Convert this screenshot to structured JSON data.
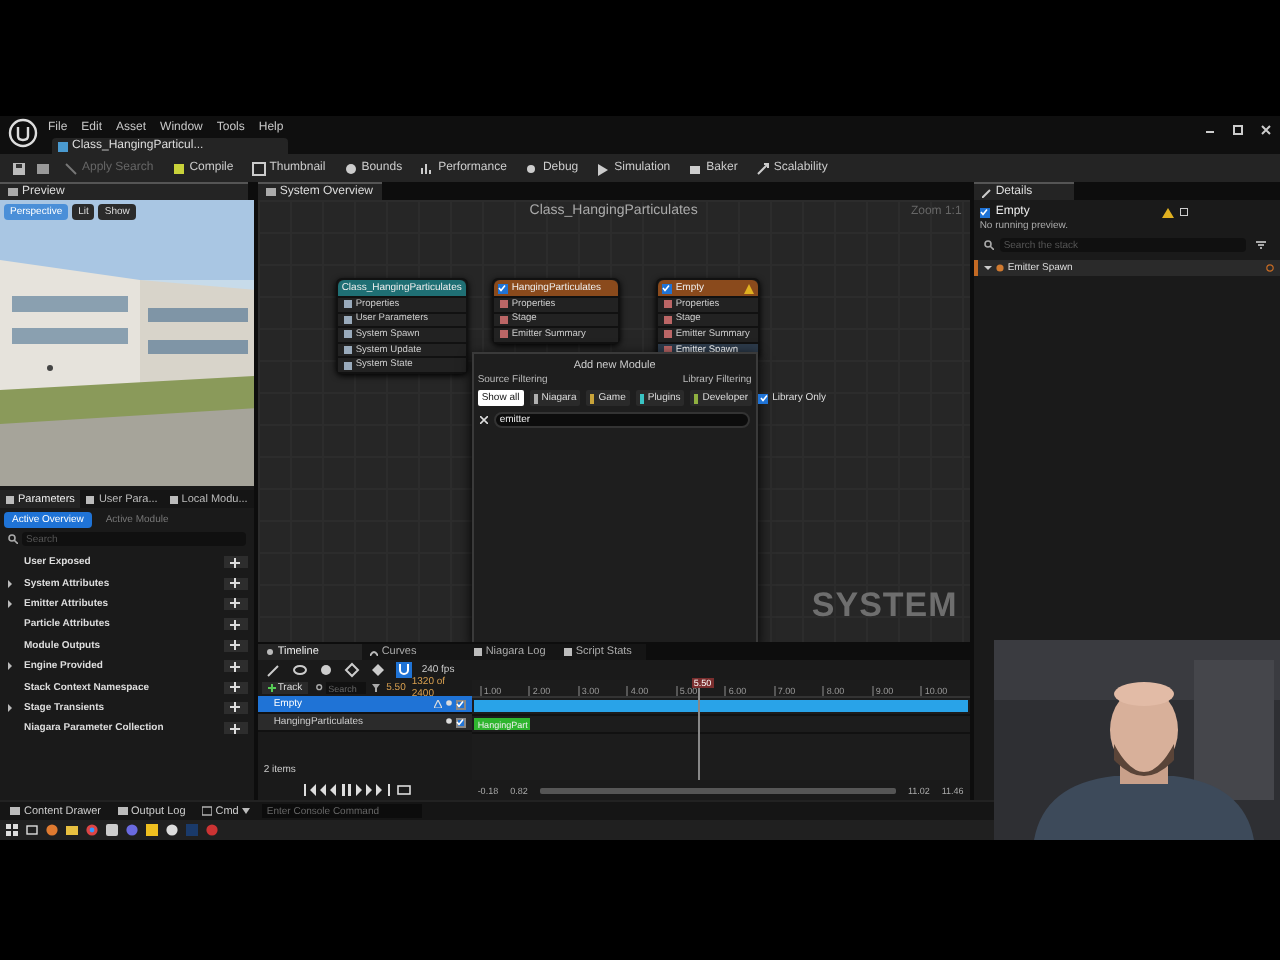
{
  "menu": [
    "File",
    "Edit",
    "Asset",
    "Window",
    "Tools",
    "Help"
  ],
  "document_tab": "Class_HangingParticul...",
  "toolbar": [
    {
      "label": "Apply Search",
      "disabled": true
    },
    {
      "label": "Compile",
      "disabled": false
    },
    {
      "label": "Thumbnail",
      "disabled": false
    },
    {
      "label": "Bounds",
      "disabled": false
    },
    {
      "label": "Performance",
      "disabled": false
    },
    {
      "label": "Debug",
      "disabled": false
    },
    {
      "label": "Simulation",
      "disabled": false
    },
    {
      "label": "Baker",
      "disabled": false
    },
    {
      "label": "Scalability",
      "disabled": false
    }
  ],
  "preview": {
    "tab": "Preview",
    "buttons": [
      "Perspective",
      "Lit",
      "Show"
    ]
  },
  "parameters": {
    "tabs": [
      {
        "label": "Parameters",
        "selected": true
      },
      {
        "label": "User Para...",
        "selected": false
      },
      {
        "label": "Local Modu...",
        "selected": false
      }
    ],
    "modes": [
      {
        "label": "Active Overview",
        "selected": true
      },
      {
        "label": "Active Module",
        "selected": false
      }
    ],
    "search_placeholder": "Search",
    "groups": [
      {
        "label": "User Exposed",
        "expandable": false
      },
      {
        "label": "System Attributes",
        "expandable": true
      },
      {
        "label": "Emitter Attributes",
        "expandable": true
      },
      {
        "label": "Particle Attributes",
        "expandable": false
      },
      {
        "label": "Module Outputs",
        "expandable": false
      },
      {
        "label": "Engine Provided",
        "expandable": true
      },
      {
        "label": "Stack Context Namespace",
        "expandable": false
      },
      {
        "label": "Stage Transients",
        "expandable": true
      },
      {
        "label": "Niagara Parameter Collection",
        "expandable": false
      }
    ]
  },
  "graph": {
    "tab": "System Overview",
    "title": "Class_HangingParticulates",
    "zoom": "Zoom 1:1",
    "watermark": "SYSTEM",
    "system_node": {
      "title": "Class_HangingParticulates",
      "rows": [
        {
          "label": "Properties",
          "selected": false
        },
        {
          "label": "User Parameters",
          "selected": false
        },
        {
          "label": "System Spawn",
          "selected": false
        },
        {
          "label": "System Update",
          "selected": false
        },
        {
          "label": "System State",
          "selected": false
        }
      ]
    },
    "emitter_nodes": [
      {
        "title": "HangingParticulates",
        "enabled": true,
        "warning": false,
        "rows": [
          {
            "label": "Properties",
            "selected": false
          },
          {
            "label": "Stage",
            "selected": false
          },
          {
            "label": "Emitter Summary",
            "selected": false
          }
        ]
      },
      {
        "title": "Empty",
        "enabled": true,
        "warning": true,
        "rows": [
          {
            "label": "Properties",
            "selected": false
          },
          {
            "label": "Stage",
            "selected": false
          },
          {
            "label": "Emitter Summary",
            "selected": false
          },
          {
            "label": "Emitter Spawn",
            "selected": true
          }
        ]
      }
    ],
    "add_module": {
      "title": "Add new Module",
      "source_filtering": "Source Filtering",
      "library_filtering": "Library Filtering",
      "filters": [
        {
          "label": "Show all",
          "color": "#ffffff"
        },
        {
          "label": "Niagara",
          "color": "#b0b0b0"
        },
        {
          "label": "Game",
          "color": "#c9a43a"
        },
        {
          "label": "Plugins",
          "color": "#3ac4c4"
        },
        {
          "label": "Developer",
          "color": "#8fb040"
        }
      ],
      "library_only": {
        "label": "Library Only",
        "checked": true
      },
      "search": "emitter"
    }
  },
  "timeline": {
    "tabs": [
      {
        "label": "Timeline",
        "selected": true
      },
      {
        "label": "Curves",
        "selected": false
      },
      {
        "label": "Niagara Log",
        "selected": false
      },
      {
        "label": "Script Stats",
        "selected": false
      }
    ],
    "fps": "240 fps",
    "track_button": "Track",
    "search_placeholder": "Search",
    "time": "5.50",
    "frame": "1320 of 2400",
    "ruler": [
      "1.00",
      "2.00",
      "3.00",
      "4.00",
      "5.00",
      "6.00",
      "7.00",
      "8.00",
      "9.00",
      "10.00"
    ],
    "playhead": "5.50",
    "tracks": [
      {
        "label": "Empty",
        "selected": true,
        "warning": true,
        "enabled": true,
        "color": "#29a3e8",
        "level": 1
      },
      {
        "label": "HangingParticulates",
        "selected": false,
        "warning": false,
        "enabled": true,
        "color": "#2fb52f",
        "level": 0.12,
        "bar_label": "HangingPart"
      }
    ],
    "item_count": "2 items",
    "range": [
      "-0.18",
      "0.82",
      "11.02",
      "11.46"
    ]
  },
  "details": {
    "tab": "Details",
    "emitter": {
      "label": "Empty",
      "enabled": true
    },
    "status": "No running preview.",
    "search_placeholder": "Search the stack",
    "items": [
      {
        "label": "Emitter Spawn",
        "expanded": true
      }
    ]
  },
  "bottom": {
    "buttons": [
      "Content Drawer",
      "Output Log"
    ],
    "cmd": "Cmd",
    "console_placeholder": "Enter Console Command"
  }
}
